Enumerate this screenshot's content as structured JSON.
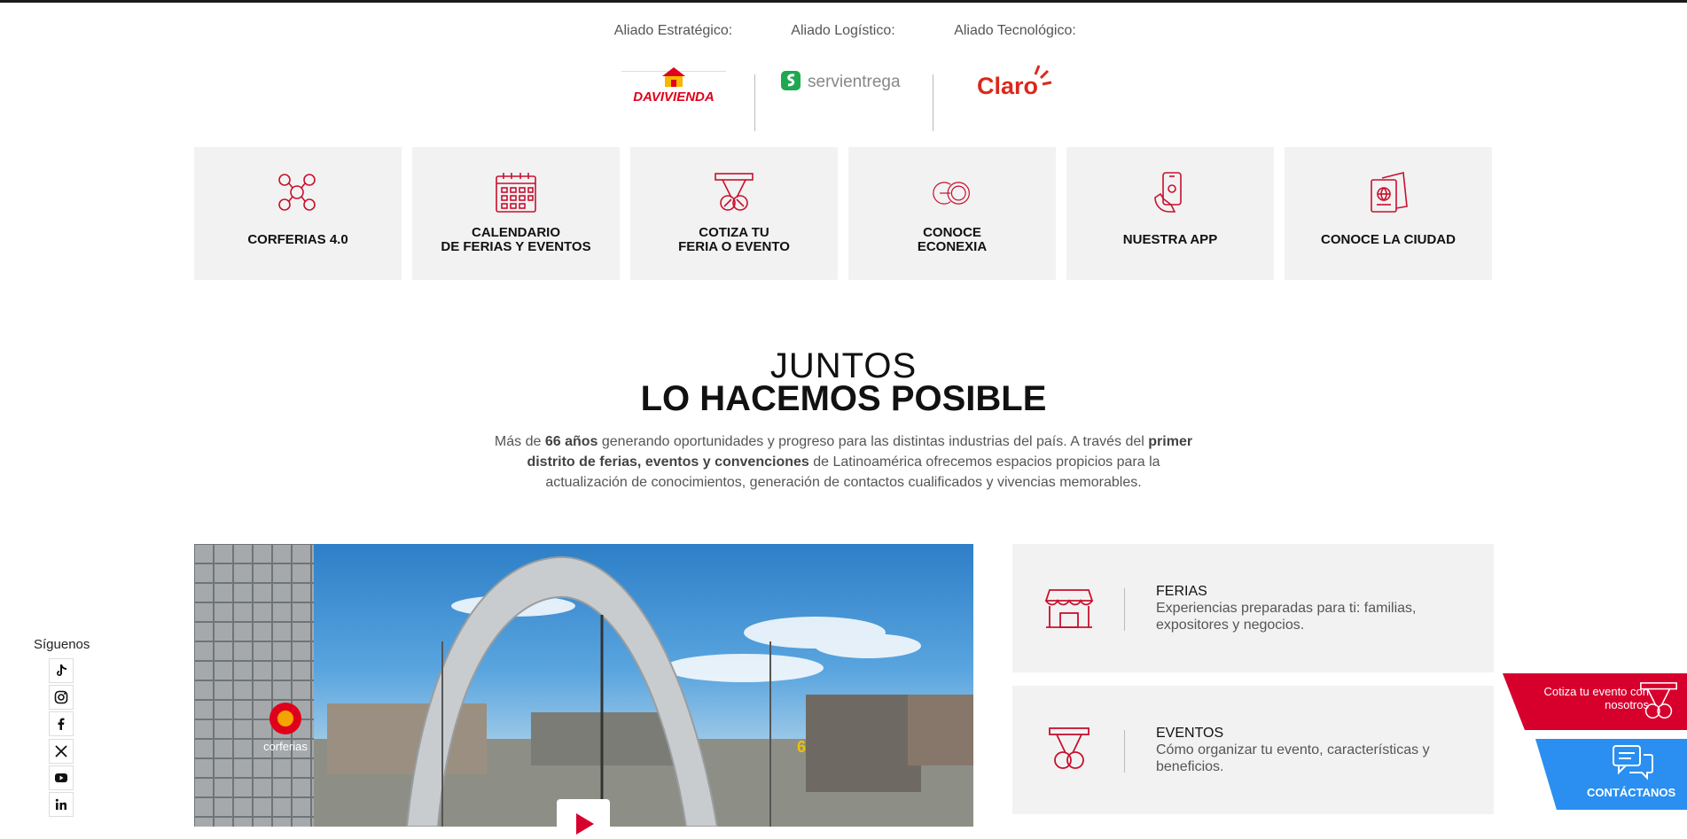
{
  "allies": [
    {
      "label": "Aliado Estratégico:",
      "brand": "DAVIVIENDA"
    },
    {
      "label": "Aliado Logístico:",
      "brand": "servientrega"
    },
    {
      "label": "Aliado Tecnológico:",
      "brand": "Claro"
    }
  ],
  "tiles": [
    {
      "line1": "CORFERIAS 4.0",
      "line2": "",
      "icon": "network-icon"
    },
    {
      "line1": "CALENDARIO",
      "line2": "DE FERIAS Y EVENTOS",
      "icon": "calendar-icon"
    },
    {
      "line1": "COTIZA TU",
      "line2": "FERIA O EVENTO",
      "icon": "quote-icon"
    },
    {
      "line1": "CONOCE",
      "line2": "ECONEXIA",
      "icon": "econexia-icon"
    },
    {
      "line1": "NUESTRA APP",
      "line2": "",
      "icon": "phone-icon"
    },
    {
      "line1": "CONOCE LA CIUDAD",
      "line2": "",
      "icon": "passport-icon"
    }
  ],
  "headline": {
    "top": "JUNTOS",
    "bottom": "LO HACEMOS POSIBLE"
  },
  "intro": {
    "p1": "Más de ",
    "b1": "66 años",
    "p2": " generando oportunidades y progreso para las distintas industrias del país. A través del ",
    "b2": "primer distrito de ferias, eventos y convenciones",
    "p3": " de Latinoamérica ofrecemos espacios propicios para la actualización de conocimientos, generación de contactos cualificados y vivencias memorables."
  },
  "video": {
    "building_label": "corferias",
    "building_number": "6"
  },
  "cards": [
    {
      "title": "FERIAS",
      "desc": "Experiencias preparadas para ti: familias, expositores y negocios."
    },
    {
      "title": "EVENTOS",
      "desc": "Cómo organizar tu evento, características y beneficios."
    }
  ],
  "social": {
    "label": "Síguenos",
    "networks": [
      "tiktok-icon",
      "instagram-icon",
      "facebook-icon",
      "x-icon",
      "youtube-icon",
      "linkedin-icon"
    ]
  },
  "cta": {
    "quote": "Cotiza tu evento con nosotros",
    "contact": "CONTÁCTANOS"
  },
  "colors": {
    "brand_red": "#d7002d",
    "blue": "#2a8ff0",
    "tile_bg": "#f2f2f2"
  }
}
